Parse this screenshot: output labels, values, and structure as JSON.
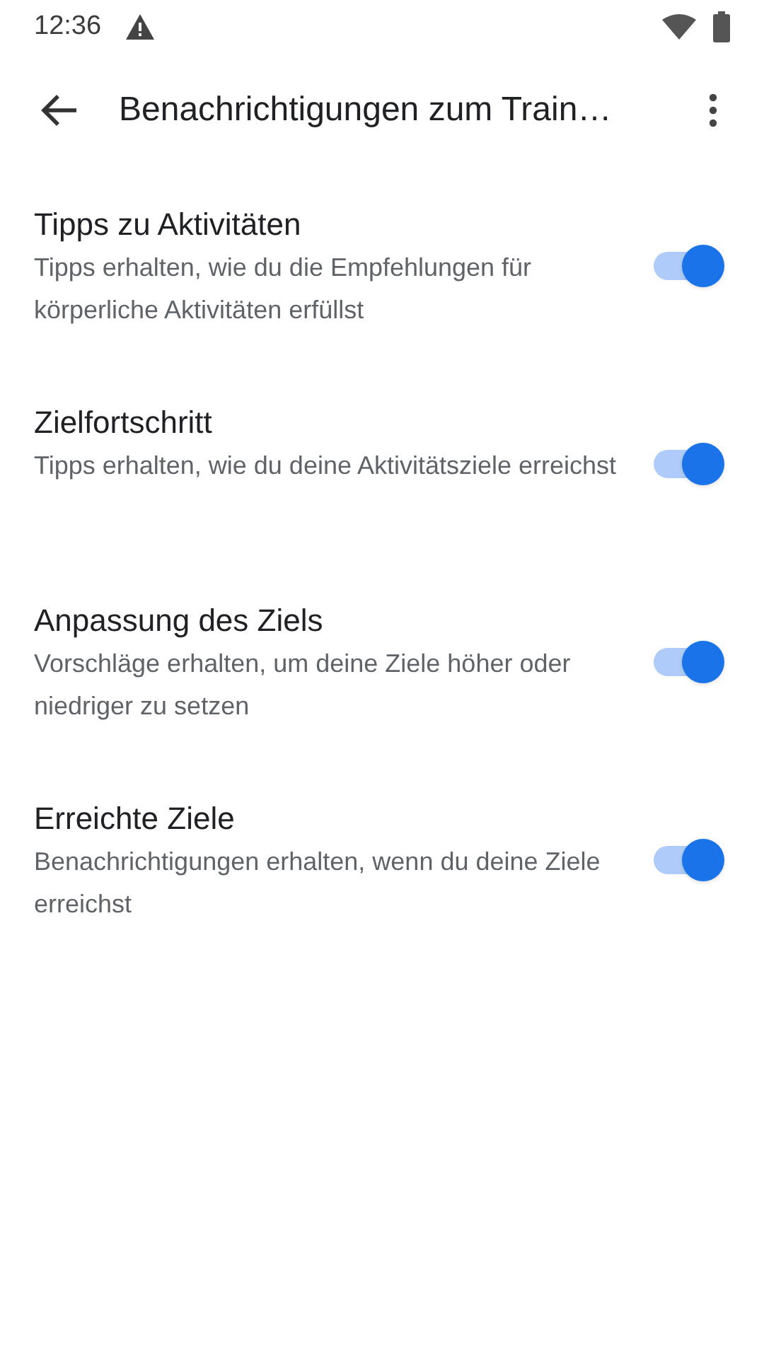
{
  "status_bar": {
    "time": "12:36"
  },
  "app_bar": {
    "title": "Benachrichtigungen zum Train…"
  },
  "settings": [
    {
      "title": "Tipps zu Aktivitäten",
      "description": "Tipps erhalten, wie du die Empfehlungen für körperliche Aktivitäten erfüllst",
      "on": true
    },
    {
      "title": "Zielfortschritt",
      "description": "Tipps erhalten, wie du deine Aktivitätsziele erreichst",
      "on": true
    },
    {
      "title": "Anpassung des Ziels",
      "description": "Vorschläge erhalten, um deine Ziele höher oder niedriger zu setzen",
      "on": true
    },
    {
      "title": "Erreichte Ziele",
      "description": "Benachrichtigungen erhalten, wenn du deine Ziele erreichst",
      "on": true
    }
  ]
}
